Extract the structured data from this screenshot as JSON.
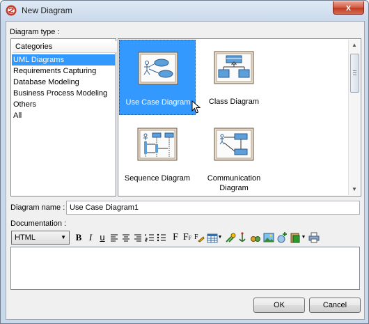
{
  "window": {
    "title": "New Diagram",
    "close_glyph": "x"
  },
  "diagram_type_label": "Diagram type :",
  "categories": {
    "header": "Categories",
    "items": [
      {
        "label": "UML Diagrams",
        "selected": true
      },
      {
        "label": "Requirements Capturing",
        "selected": false
      },
      {
        "label": "Database Modeling",
        "selected": false
      },
      {
        "label": "Business Process Modeling",
        "selected": false
      },
      {
        "label": "Others",
        "selected": false
      },
      {
        "label": "All",
        "selected": false
      }
    ]
  },
  "diagrams": [
    {
      "name": "Use Case Diagram",
      "selected": true,
      "icon": "use-case-diagram-icon"
    },
    {
      "name": "Class Diagram",
      "selected": false,
      "icon": "class-diagram-icon"
    },
    {
      "name": "Sequence Diagram",
      "selected": false,
      "icon": "sequence-diagram-icon"
    },
    {
      "name": "Communication Diagram",
      "selected": false,
      "icon": "communication-diagram-icon"
    }
  ],
  "diagram_name": {
    "label": "Diagram name :",
    "value": "Use Case Diagram1"
  },
  "documentation": {
    "label": "Documentation :",
    "format": "HTML",
    "toolbar": {
      "bold": "B",
      "italic": "I",
      "underline": "u",
      "font": "F",
      "font_size": "F",
      "font_size_sub": "F"
    },
    "value": ""
  },
  "buttons": {
    "ok": "OK",
    "cancel": "Cancel"
  },
  "colors": {
    "selection": "#3399ff",
    "frame": "#c9d9ec"
  }
}
